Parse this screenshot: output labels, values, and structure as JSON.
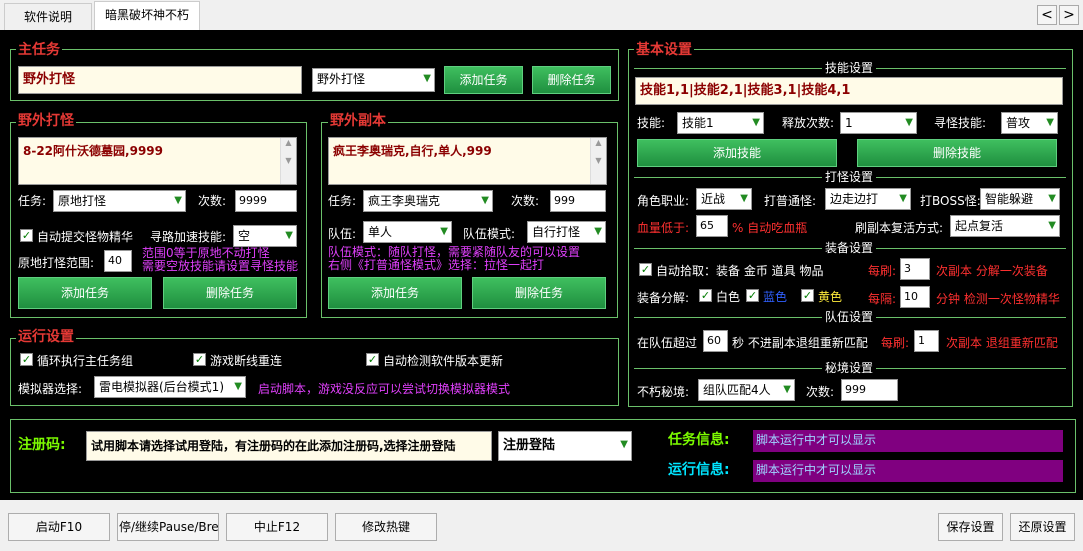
{
  "tabs": [
    "软件说明",
    "暗黑破坏神不朽"
  ],
  "nav": {
    "prev": "<",
    "next": ">"
  },
  "main_task": {
    "title": "主任务",
    "value": "野外打怪",
    "select": "野外打怪",
    "add": "添加任务",
    "del": "删除任务"
  },
  "field": {
    "title": "野外打怪",
    "text": "8-22阿什沃德墓园,9999",
    "task_label": "任务:",
    "task_select": "原地打怪",
    "count_label": "次数:",
    "count_value": "9999",
    "auto_submit": "自动提交怪物精华",
    "speedup_label": "寻路加速技能:",
    "speedup_select": "空",
    "range_label": "原地打怪范围:",
    "range_value": "40",
    "range_note1": "范围0等于原地不动打怪",
    "range_note2": "需要空放技能请设置寻怪技能",
    "add": "添加任务",
    "del": "删除任务"
  },
  "dungeon": {
    "title": "野外副本",
    "text": "疯王李奥瑞克,自行,单人,999",
    "task_label": "任务:",
    "task_select": "疯王李奥瑞克",
    "count_label": "次数:",
    "count_value": "999",
    "team_label": "队伍:",
    "team_select": "单人",
    "mode_label": "队伍模式:",
    "mode_select": "自行打怪",
    "note1": "队伍模式：随队打怪，需要紧随队友的可以设置",
    "note2": "右侧《打普通怪模式》选择：拉怪一起打",
    "add": "添加任务",
    "del": "删除任务"
  },
  "run": {
    "title": "运行设置",
    "loop": "循环执行主任务组",
    "reconnect": "游戏断线重连",
    "autodetect": "自动检测软件版本更新",
    "emu_label": "模拟器选择:",
    "emu_select": "雷电模拟器(后台模式1)",
    "emu_note": "启动脚本，游戏没反应可以尝试切换模拟器模式"
  },
  "basic": {
    "title": "基本设置",
    "skill_title": "技能设置",
    "skill_text": "技能1,1|技能2,1|技能3,1|技能4,1",
    "skill_label": "技能:",
    "skill_select": "技能1",
    "release_label": "释放次数:",
    "release_select": "1",
    "seek_label": "寻怪技能:",
    "seek_select": "普攻",
    "add_skill": "添加技能",
    "del_skill": "删除技能",
    "fight_title": "打怪设置",
    "role_label": "角色职业:",
    "role_select": "近战",
    "normal_label": "打普通怪:",
    "normal_select": "边走边打",
    "boss_label": "打BOSS怪:",
    "boss_select": "智能躲避",
    "hp_label": "血量低于:",
    "hp_value": "65",
    "hp_note": "% 自动吃血瓶",
    "revive_label": "刷副本复活方式:",
    "revive_select": "起点复活",
    "equip_title": "装备设置",
    "pickup_label": "自动拾取：装备 金币 道具 物品",
    "every_label1": "每刷:",
    "every_value1": "3",
    "every_note1": "次副本 分解一次装备",
    "decomp_label": "装备分解:",
    "white": "白色",
    "blue": "蓝色",
    "yellow": "黄色",
    "every_label2": "每隔:",
    "every_value2": "10",
    "every_note2": "分钟 检测一次怪物精华",
    "team_title": "队伍设置",
    "team_over_label": "在队伍超过",
    "team_over_value": "60",
    "team_over_note": "秒 不进副本退组重新匹配",
    "team_every_label": "每刷:",
    "team_every_value": "1",
    "team_every_note": "次副本 退组重新匹配",
    "secret_title": "秘境设置",
    "secret_label": "不朽秘境:",
    "secret_select": "组队匹配4人",
    "secret_count_label": "次数:",
    "secret_count_value": "999"
  },
  "reg": {
    "label": "注册码:",
    "value": "试用脚本请选择试用登陆，有注册码的在此添加注册码,选择注册登陆",
    "select": "注册登陆",
    "task_info_label": "任务信息:",
    "task_info": "脚本运行中才可以显示",
    "run_info_label": "运行信息:",
    "run_info": "脚本运行中才可以显示"
  },
  "bottom": {
    "start": "启动F10",
    "pause": "停/继续Pause/Break",
    "stop": "中止F12",
    "hotkey": "修改热键",
    "save": "保存设置",
    "restore": "还原设置"
  }
}
